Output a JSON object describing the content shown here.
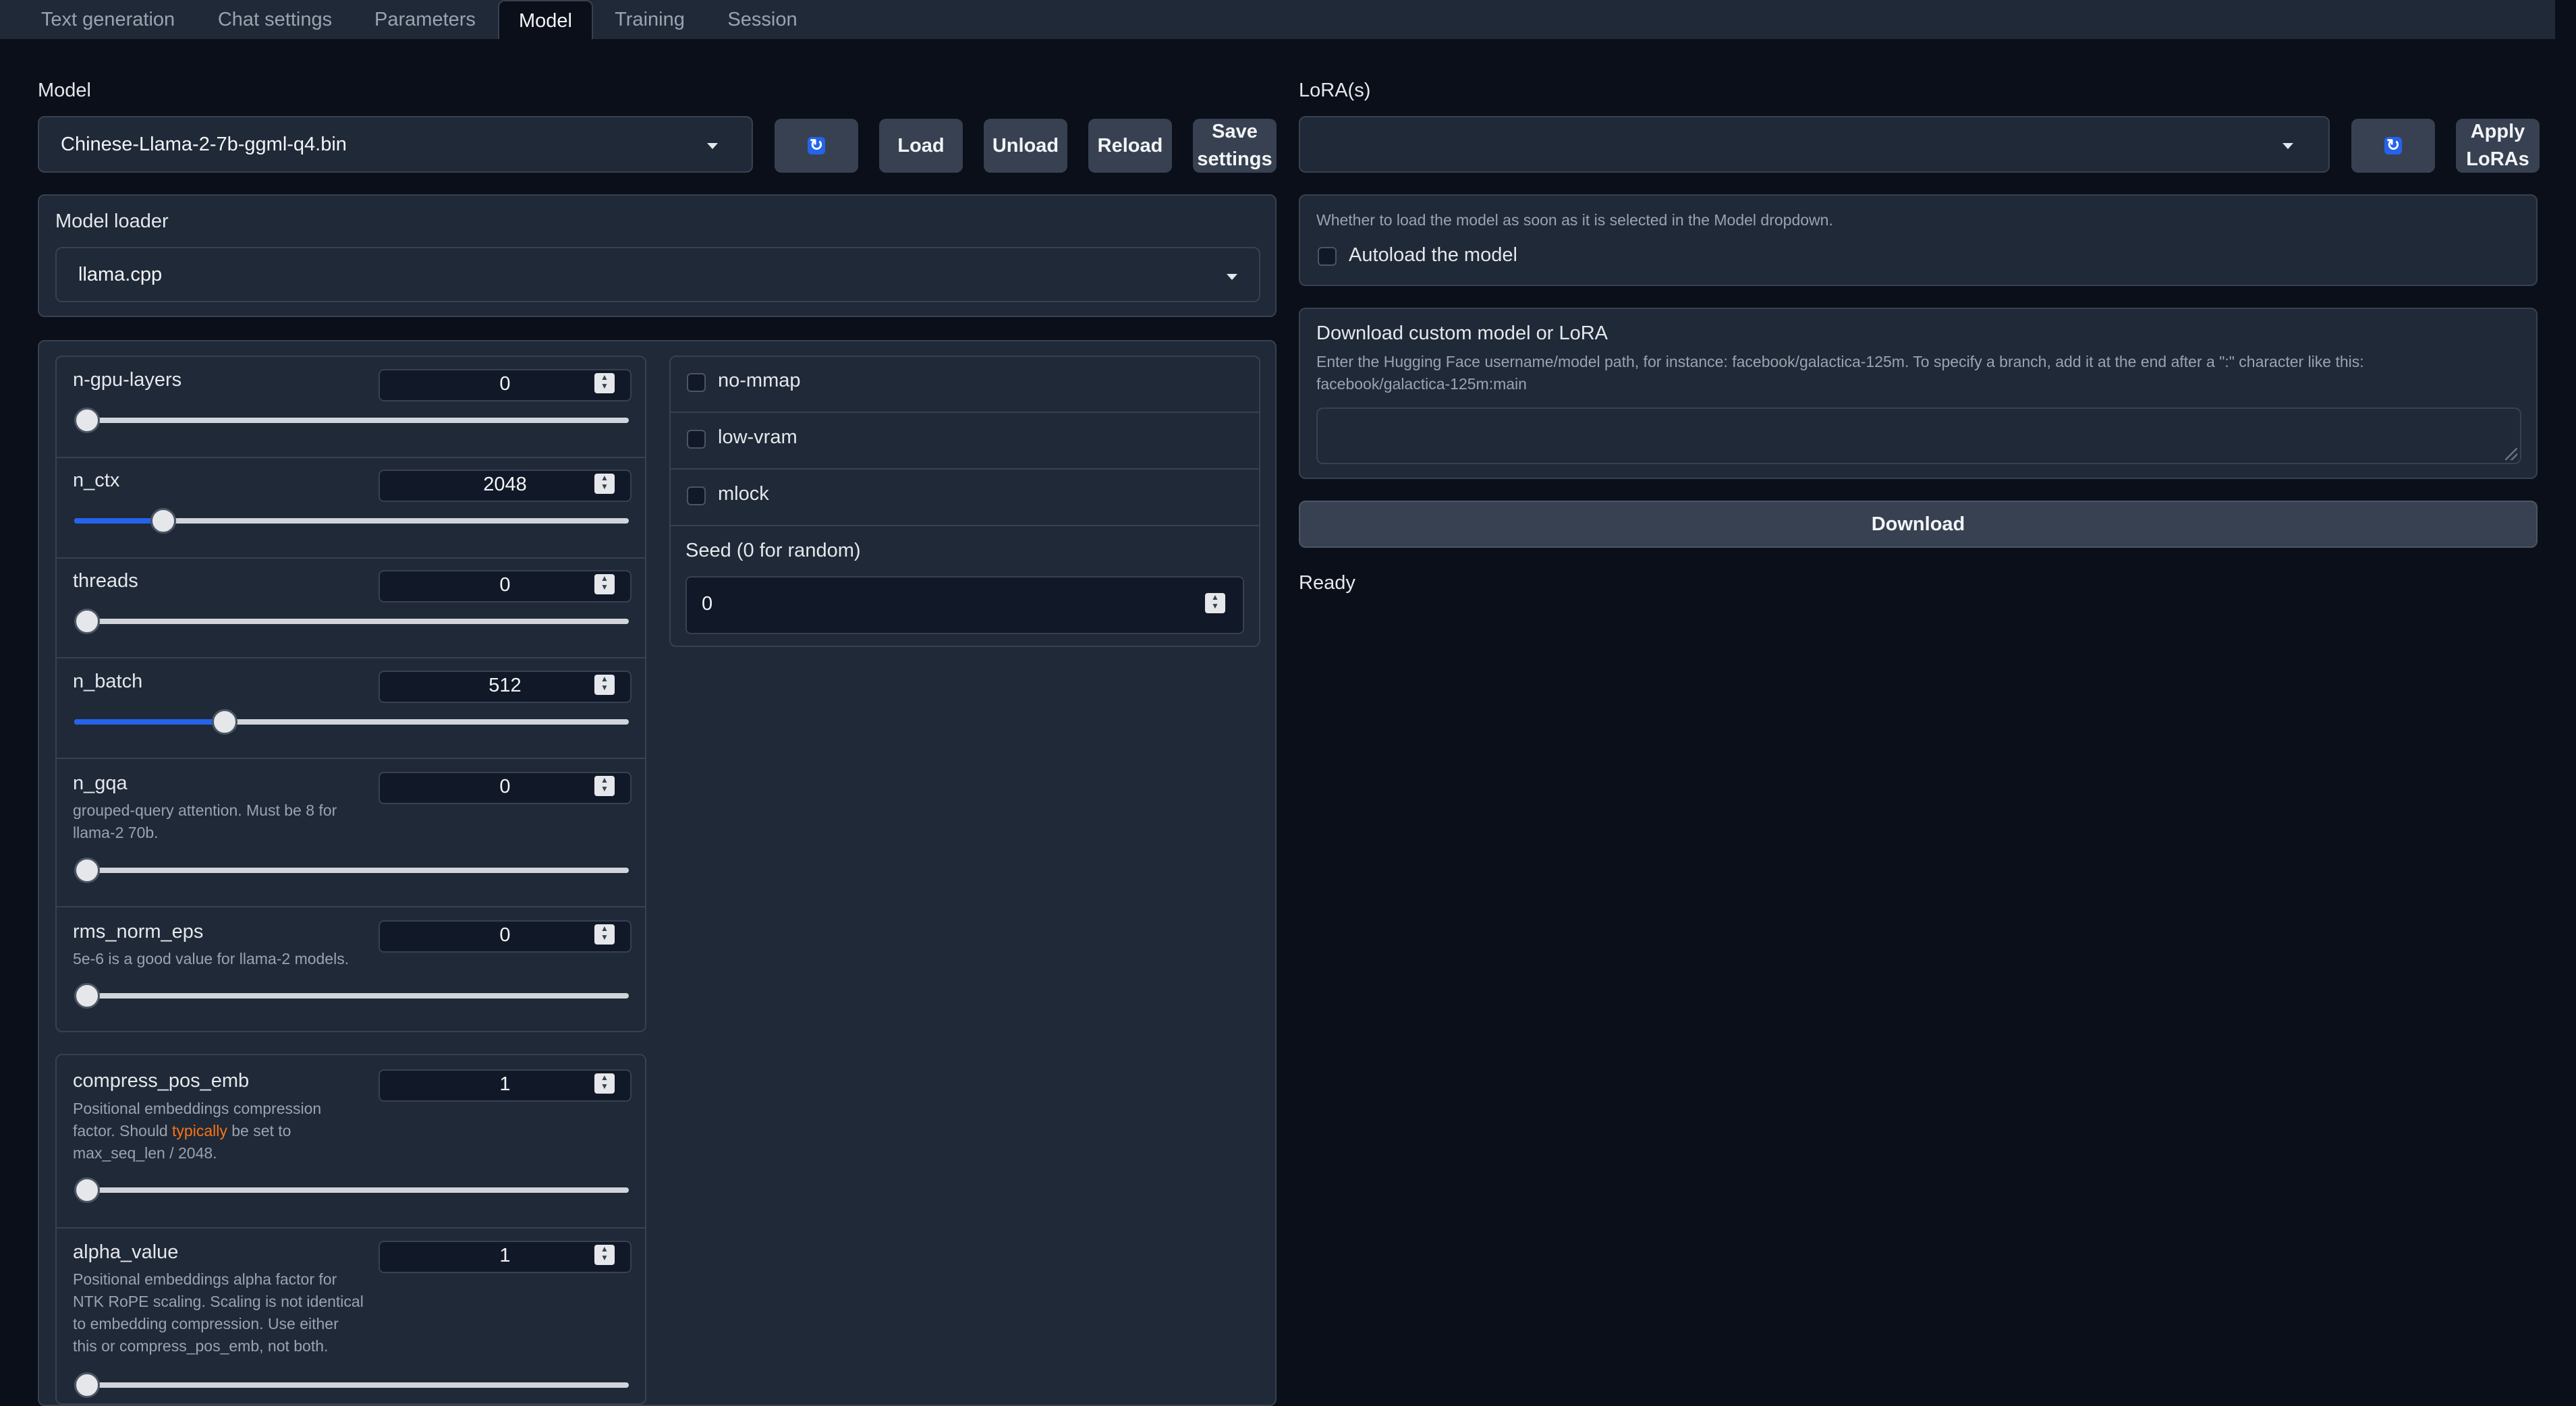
{
  "tabs": [
    {
      "label": "Text generation",
      "active": false
    },
    {
      "label": "Chat settings",
      "active": false
    },
    {
      "label": "Parameters",
      "active": false
    },
    {
      "label": "Model",
      "active": true
    },
    {
      "label": "Training",
      "active": false
    },
    {
      "label": "Session",
      "active": false
    }
  ],
  "model": {
    "label": "Model",
    "selected": "Chinese-Llama-2-7b-ggml-q4.bin",
    "buttons": {
      "load": "Load",
      "unload": "Unload",
      "reload": "Reload",
      "save_line1": "Save",
      "save_line2": "settings"
    }
  },
  "loader": {
    "label": "Model loader",
    "selected": "llama.cpp"
  },
  "params": [
    {
      "label": "n-gpu-layers",
      "value": "0",
      "fraction": 0.0,
      "desc": ""
    },
    {
      "label": "n_ctx",
      "value": "2048",
      "fraction": 0.144,
      "desc": ""
    },
    {
      "label": "threads",
      "value": "0",
      "fraction": 0.0,
      "desc": ""
    },
    {
      "label": "n_batch",
      "value": "512",
      "fraction": 0.26,
      "desc": ""
    },
    {
      "label": "n_gqa",
      "value": "0",
      "fraction": 0.0,
      "desc_lines": [
        "grouped-query attention. Must be 8 for",
        "llama-2 70b."
      ]
    },
    {
      "label": "rms_norm_eps",
      "value": "0",
      "fraction": 0.0,
      "desc_lines": [
        "5e-6 is a good value for llama-2 models."
      ]
    }
  ],
  "rope": [
    {
      "label": "compress_pos_emb",
      "value": "1",
      "fraction": 0.0,
      "desc": {
        "line1": "Positional embeddings compression",
        "line2_pre": "factor. Should ",
        "line2_hl": "typically",
        "line2_post": " be set to",
        "line3": "max_seq_len / 2048."
      }
    },
    {
      "label": "alpha_value",
      "value": "1",
      "fraction": 0.0,
      "desc_lines": [
        "Positional embeddings alpha factor for",
        "NTK RoPE scaling. Scaling is not identical",
        "to embedding compression. Use either",
        "this or compress_pos_emb, not both."
      ]
    }
  ],
  "checkboxes": [
    {
      "label": "no-mmap",
      "checked": false
    },
    {
      "label": "low-vram",
      "checked": false
    },
    {
      "label": "mlock",
      "checked": false
    }
  ],
  "seed": {
    "label": "Seed (0 for random)",
    "value": "0"
  },
  "lora": {
    "label": "LoRA(s)",
    "selected": "",
    "apply_line1": "Apply",
    "apply_line2": "LoRAs"
  },
  "autoload": {
    "desc": "Whether to load the model as soon as it is selected in the Model dropdown.",
    "label": "Autoload the model",
    "checked": false
  },
  "download": {
    "title": "Download custom model or LoRA",
    "desc_line1": "Enter the Hugging Face username/model path, for instance: facebook/galactica-125m. To specify a branch, add it at the end after a \":\" character like this:",
    "desc_line2": "facebook/galactica-125m:main",
    "input_value": "",
    "button": "Download",
    "status": "Ready"
  },
  "colors": {
    "accent": "#2563eb",
    "background": "#0b0f19",
    "panel": "#1f2937",
    "highlight": "#f97316"
  }
}
